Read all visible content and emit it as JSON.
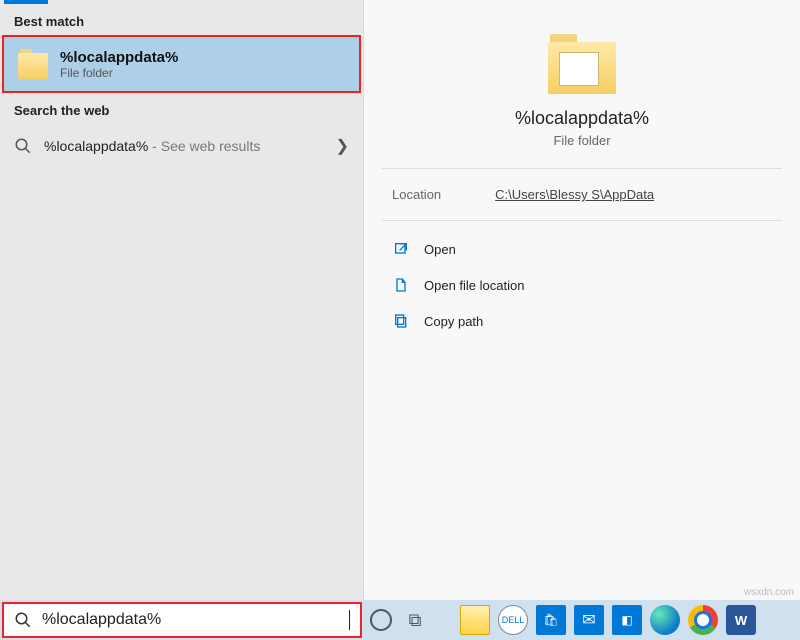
{
  "left": {
    "best_match_heading": "Best match",
    "result": {
      "title": "%localappdata%",
      "subtitle": "File folder"
    },
    "web_heading": "Search the web",
    "web_result": {
      "term": "%localappdata%",
      "suffix": " - See web results"
    }
  },
  "preview": {
    "title": "%localappdata%",
    "subtitle": "File folder",
    "location_label": "Location",
    "location_value": "C:\\Users\\Blessy S\\AppData",
    "actions": {
      "open": "Open",
      "open_location": "Open file location",
      "copy_path": "Copy path"
    }
  },
  "search": {
    "value": "%localappdata%"
  },
  "taskbar": {
    "cortana": "○",
    "taskview": "⊞",
    "word": "W"
  },
  "watermark": "wsxdn.com"
}
